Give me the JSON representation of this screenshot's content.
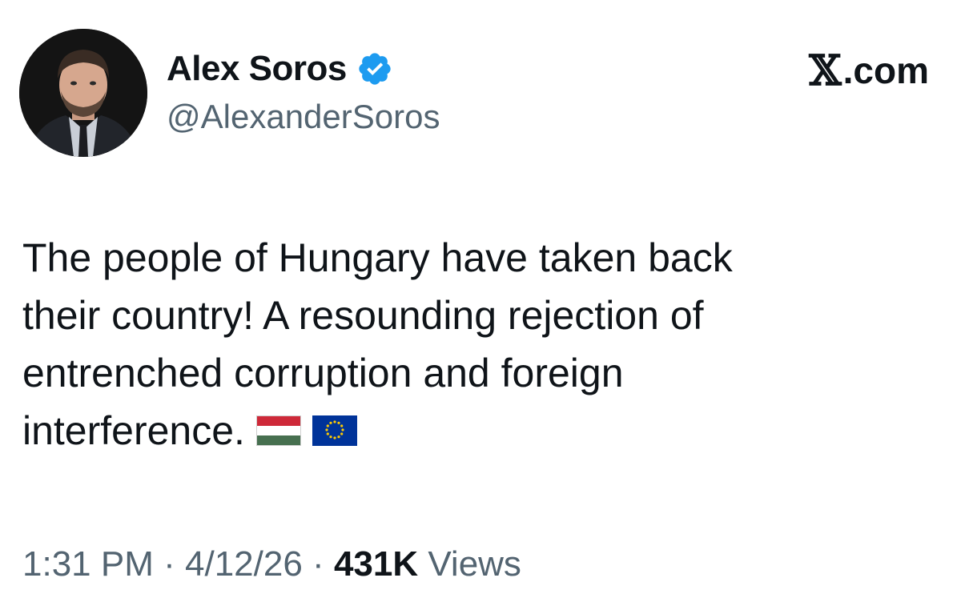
{
  "author": {
    "display_name": "Alex Soros",
    "handle": "@AlexanderSoros",
    "verified": true
  },
  "brand": {
    "x_glyph": "𝕏",
    "suffix": ".com"
  },
  "tweet": {
    "lines": [
      "The people of Hungary have taken back",
      "their country! A resounding rejection of",
      "entrenched corruption and foreign",
      "interference."
    ],
    "flags": [
      "hungary-flag-icon",
      "eu-flag-icon"
    ]
  },
  "meta": {
    "time": "1:31 PM",
    "separator": "·",
    "date": "4/12/26",
    "views_count": "431K",
    "views_label": "Views"
  },
  "colors": {
    "text": "#0f1419",
    "secondary": "#536471",
    "verified": "#1d9bf0",
    "hungary_red": "#ce2939",
    "hungary_white": "#ffffff",
    "hungary_green": "#477050",
    "eu_blue": "#003399",
    "eu_star": "#ffcc00"
  }
}
